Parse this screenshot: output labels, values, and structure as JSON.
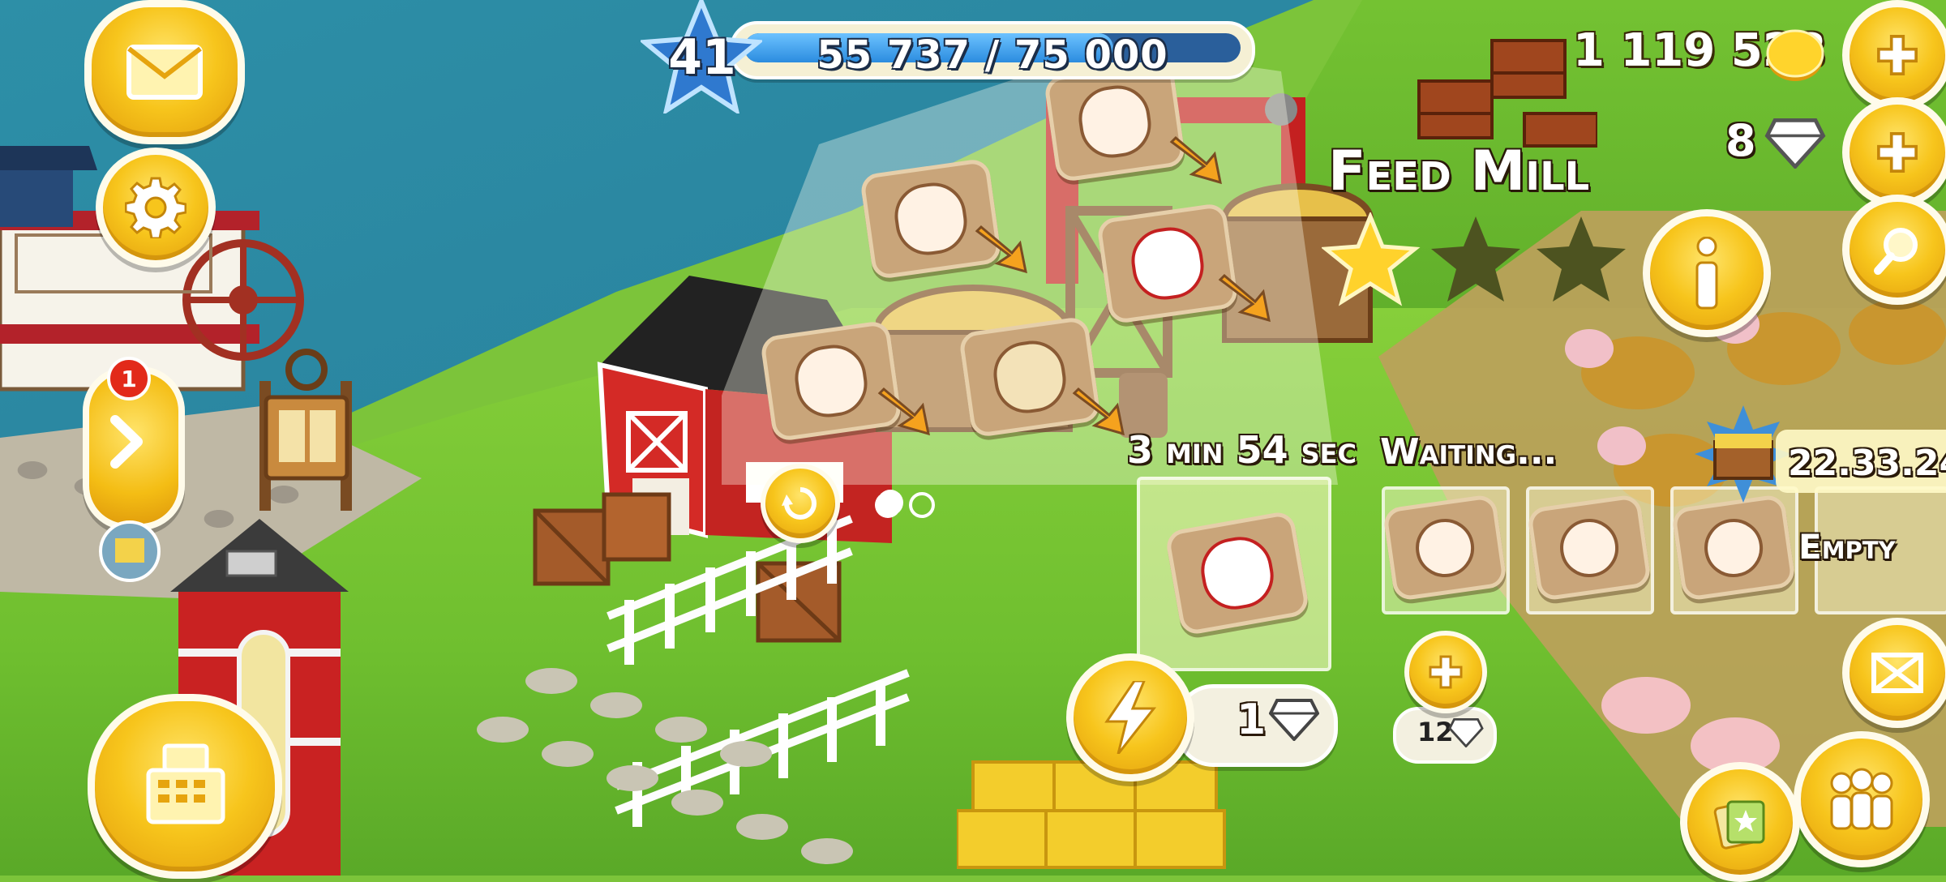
{
  "hud": {
    "level": "41",
    "xp_text": "55 737 / 75 000",
    "xp_progress": 0.743,
    "coins": "1 119 528",
    "gems": "8",
    "mail_badge": "1"
  },
  "feed_mill": {
    "title": "Feed Mill",
    "stars_filled": 1,
    "stars_total": 3,
    "timer": "3 min 54 sec",
    "waiting_label": "Waiting...",
    "empty_label": "Empty",
    "queue_timer": "22.33.24",
    "speed_up_cost": "1",
    "new_slot_cost": "12",
    "queue": [
      "chicken-feed",
      "pig-feed",
      "pig-feed",
      "pig-feed",
      "empty"
    ],
    "recipes": [
      "pig-feed",
      "sheep-feed",
      "chicken-feed",
      "goat-feed",
      "cow-feed"
    ]
  },
  "colors": {
    "accent": "#f7c51c",
    "button_border": "#fffbea",
    "xp_blue": "#2b8cdf",
    "water": "#2a85a0",
    "grass": "#7cc43a"
  },
  "icons": {
    "mail": "envelope-icon",
    "settings": "gear-icon",
    "side_tab": "chevron-right-icon",
    "shop": "cash-register-icon",
    "info": "info-icon",
    "search": "magnifier-icon",
    "expand": "expand-arrows-icon",
    "friends": "friends-icon",
    "cards": "cards-icon",
    "speed_up": "lightning-icon",
    "rotate": "rotate-icon"
  }
}
